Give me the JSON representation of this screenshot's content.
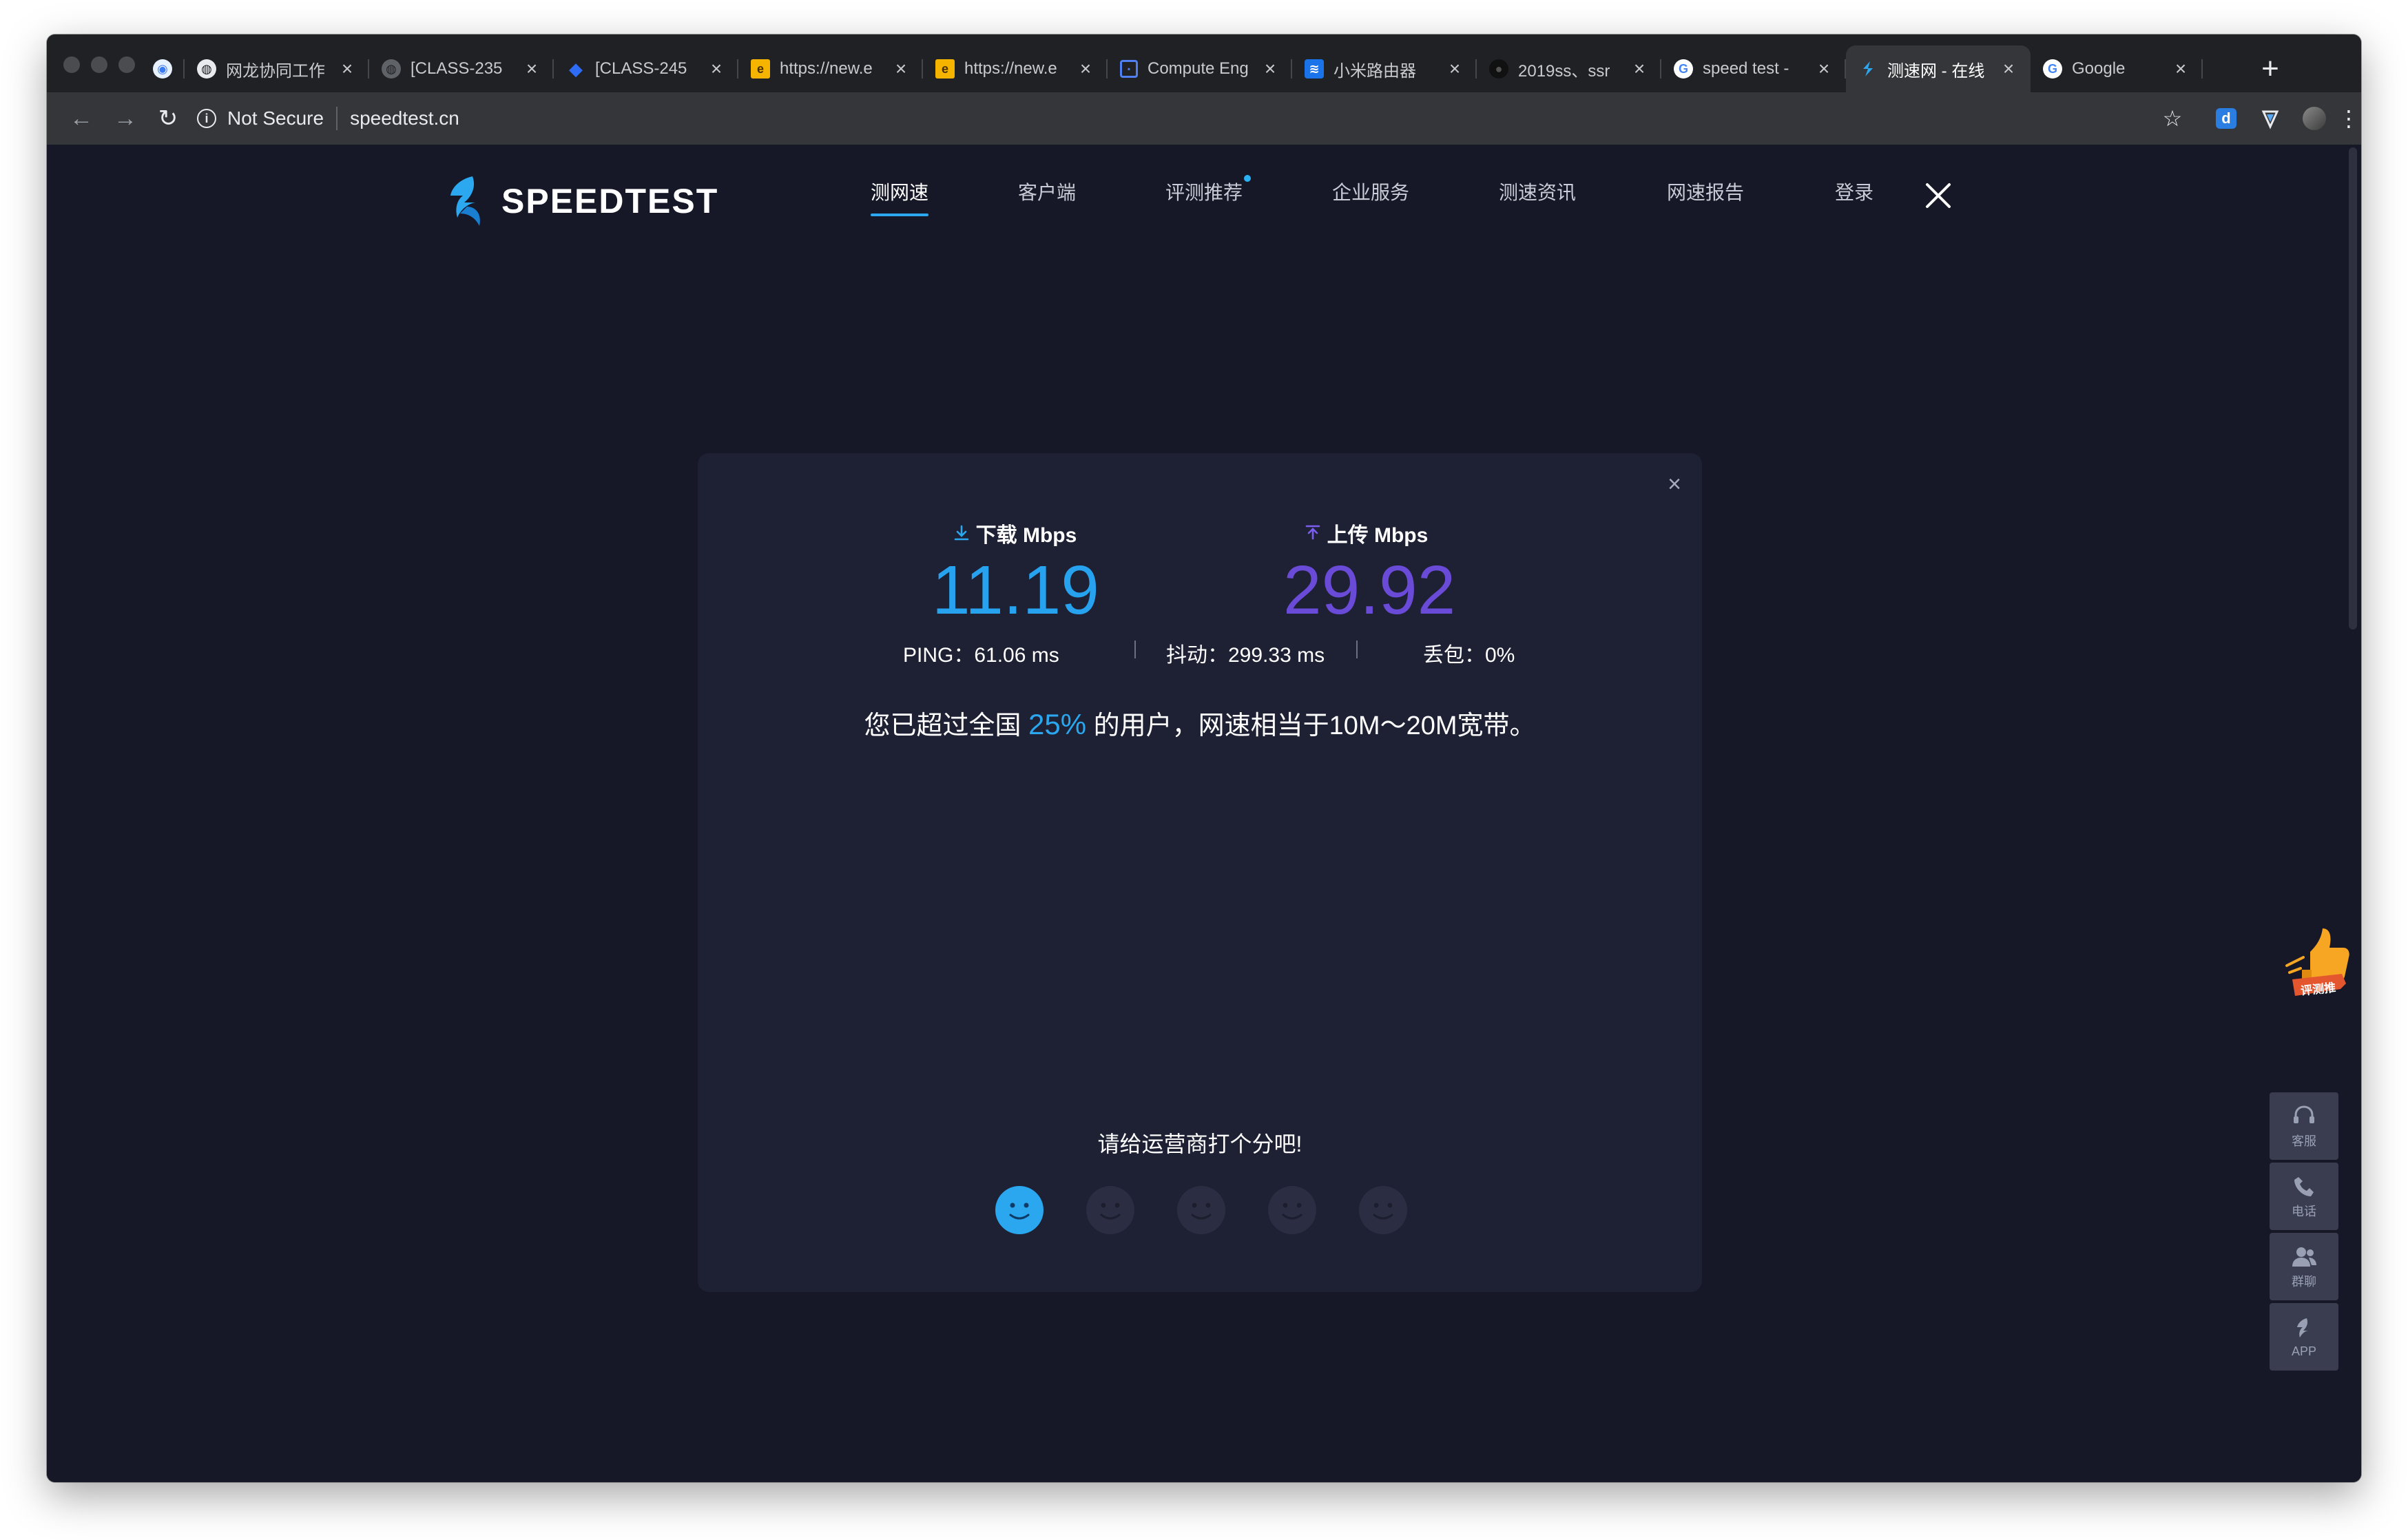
{
  "browser": {
    "tabs": [
      {
        "title": "",
        "favicon": "globe-blue-icon",
        "active": false
      },
      {
        "title": "网龙协同工作",
        "favicon": "globe-icon",
        "active": false
      },
      {
        "title": "[CLASS-235",
        "favicon": "globe-gray-icon",
        "active": false
      },
      {
        "title": "[CLASS-245",
        "favicon": "jira-icon",
        "active": false
      },
      {
        "title": "https://new.e",
        "favicon": "e-yellow-icon",
        "active": false
      },
      {
        "title": "https://new.e",
        "favicon": "e-yellow-icon",
        "active": false
      },
      {
        "title": "Compute Eng",
        "favicon": "chip-icon",
        "active": false
      },
      {
        "title": "小米路由器",
        "favicon": "wifi-icon",
        "active": false
      },
      {
        "title": "2019ss、ssr",
        "favicon": "github-icon",
        "active": false
      },
      {
        "title": "speed test -",
        "favicon": "google-icon",
        "active": false
      },
      {
        "title": "测速网 - 在线",
        "favicon": "speedtest-icon",
        "active": true
      },
      {
        "title": "Google",
        "favicon": "google-icon",
        "active": false
      }
    ],
    "address": {
      "security": "Not Secure",
      "url": "speedtest.cn"
    }
  },
  "site": {
    "logo_text": "SPEEDTEST",
    "nav": [
      "测网速",
      "客户端",
      "评测推荐",
      "企业服务",
      "测速资讯",
      "网速报告",
      "登录"
    ]
  },
  "result": {
    "download": {
      "label": "下载 Mbps",
      "value": "11.19"
    },
    "upload": {
      "label": "上传 Mbps",
      "value": "29.92"
    },
    "ping": "PING：61.06 ms",
    "jitter": "抖动：299.33 ms",
    "loss": "丢包：0%",
    "sentence_pre": "您已超过全国 ",
    "percent": "25%",
    "sentence_post": " 的用户，网速相当于10M～20M宽带。",
    "rate_prompt": "请给运营商打个分吧!",
    "rating_selected": 1,
    "rating_max": 5
  },
  "sidebar": {
    "promo_label": "评测推",
    "items": [
      {
        "label": "客服",
        "icon": "headset-icon"
      },
      {
        "label": "电话",
        "icon": "phone-icon"
      },
      {
        "label": "群聊",
        "icon": "group-icon"
      },
      {
        "label": "APP",
        "icon": "app-logo-icon"
      }
    ]
  },
  "colors": {
    "background": "#161827",
    "card": "#1e2034",
    "download": "#27a2ee",
    "upload": "#6a4bd8",
    "accent": "#2aa7ee"
  }
}
